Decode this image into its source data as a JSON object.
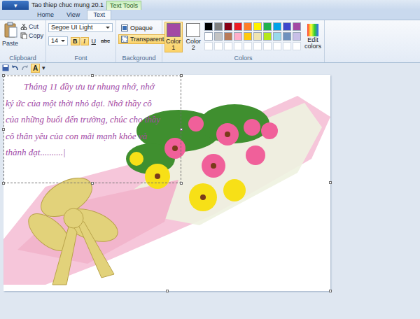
{
  "window": {
    "title": "Tao thiep chuc mung 20.1",
    "app_menu": "▾"
  },
  "contextual_tab": "Text Tools",
  "tabs": [
    {
      "label": "Home",
      "selected": false
    },
    {
      "label": "View",
      "selected": false
    },
    {
      "label": "Text",
      "selected": true
    }
  ],
  "clipboard": {
    "label": "Clipboard",
    "paste": "Paste",
    "cut": "Cut",
    "copy": "Copy"
  },
  "font": {
    "label": "Font",
    "family": "Segoe UI Light",
    "size": "14",
    "styles": [
      {
        "glyph": "B",
        "selected": true
      },
      {
        "glyph": "I",
        "selected": true
      },
      {
        "glyph": "U",
        "selected": false
      },
      {
        "glyph": "abc",
        "selected": false
      }
    ]
  },
  "background": {
    "label": "Background",
    "options": [
      {
        "label": "Opaque",
        "selected": false
      },
      {
        "label": "Transparent",
        "selected": true
      }
    ]
  },
  "colors": {
    "label": "Colors",
    "slots": [
      {
        "label": "Color 1",
        "color": "#a349a4",
        "selected": true
      },
      {
        "label": "Color 2",
        "color": "#ffffff",
        "selected": false
      }
    ],
    "palette": [
      {
        "color": "#000000"
      },
      {
        "color": "#7f7f7f"
      },
      {
        "color": "#880015"
      },
      {
        "color": "#ed1c24"
      },
      {
        "color": "#ff7f27"
      },
      {
        "color": "#fff200"
      },
      {
        "color": "#22b14c"
      },
      {
        "color": "#00a2e8"
      },
      {
        "color": "#3f48cc"
      },
      {
        "color": "#a349a4"
      },
      {
        "color": "#ffffff"
      },
      {
        "color": "#c3c3c3"
      },
      {
        "color": "#b97a57"
      },
      {
        "color": "#ffaec9"
      },
      {
        "color": "#ffc90e"
      },
      {
        "color": "#efe4b0"
      },
      {
        "color": "#b5e61d"
      },
      {
        "color": "#99d9ea"
      },
      {
        "color": "#7092be"
      },
      {
        "color": "#c8bfe7"
      }
    ],
    "empty_slots": 10,
    "edit": "Edit colors"
  },
  "quick_access": {
    "text_tool": {
      "glyph": "A",
      "selected": true
    },
    "more": "▾"
  },
  "canvas": {
    "text_box": {
      "lines": [
        "Tháng 11 đầy ưu tư nhung nhớ, nhớ",
        "ký ức của một thời nhỏ dại. Nhớ thầy cô",
        "của những buổi đến trường, chúc cho thầy",
        "cô thân yêu của con mãi mạnh khỏe và",
        "thành đạt..........|"
      ]
    }
  }
}
